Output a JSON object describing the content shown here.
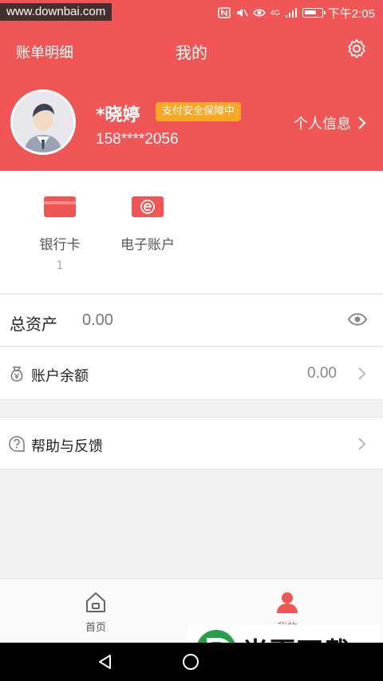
{
  "status_bar": {
    "watermark": "www.downbai.com",
    "network": "4G",
    "time": "下午2:05",
    "icons": [
      "nfc-icon",
      "mute-icon",
      "eye-icon",
      "signal-icon",
      "battery-icon"
    ]
  },
  "header": {
    "left_link": "账单明细",
    "title": "我的",
    "settings_icon": "gear-icon",
    "username": "*晓婷",
    "badge": "支付安全保障中",
    "phone": "158****2056",
    "profile_link": "个人信息"
  },
  "accounts": {
    "items": [
      {
        "label": "银行卡",
        "count": "1",
        "icon": "bank-card-icon"
      },
      {
        "label": "电子账户",
        "count": "",
        "icon": "e-account-icon"
      }
    ]
  },
  "total_assets": {
    "label": "总资产",
    "value": "0.00"
  },
  "rows": {
    "balance": {
      "label": "账户余额",
      "value": "0.00"
    },
    "help": {
      "label": "帮助与反馈"
    }
  },
  "tabbar": {
    "tabs": [
      {
        "label": "首页",
        "icon": "home-icon"
      },
      {
        "label": "我的",
        "icon": "person-icon"
      }
    ]
  },
  "watermark_bottom": {
    "text": "当百下载"
  },
  "colors": {
    "brand_red": "#f05656",
    "badge_orange": "#f9a825",
    "watermark_green": "#22a04b"
  }
}
